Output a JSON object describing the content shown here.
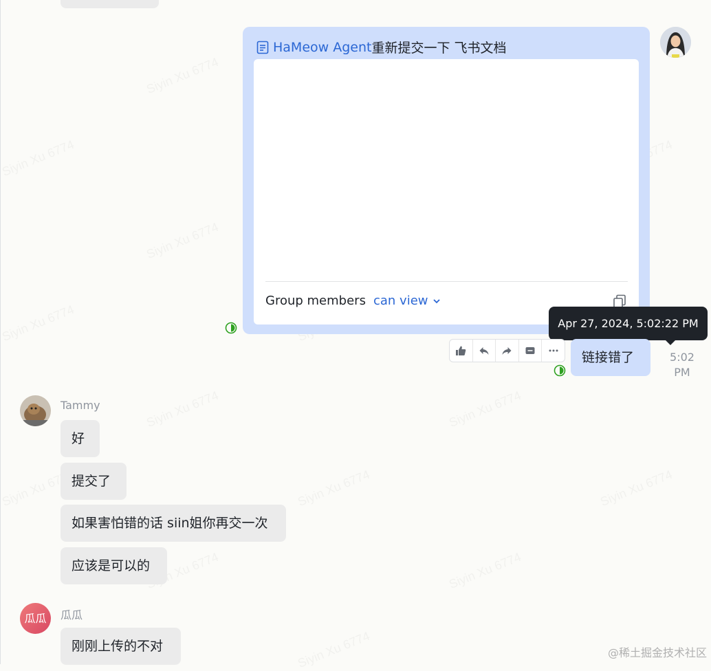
{
  "watermark_text": "Siyin Xu 6774",
  "card": {
    "icon": "document-icon",
    "link_text": "HaMeow Agent",
    "rest_text": "重新提交一下 飞书文档",
    "permission_label": "Group members",
    "permission_value": "can view"
  },
  "self_message": {
    "text": "链接错了"
  },
  "tooltip": {
    "text": "Apr 27, 2024, 5:02:22 PM"
  },
  "time": {
    "line1": "5:02",
    "line2": "PM"
  },
  "toolbar": {
    "icons": [
      "thumbs-up-icon",
      "reply-icon",
      "forward-icon",
      "quote-icon",
      "more-icon"
    ]
  },
  "groups": [
    {
      "sender": "Tammy",
      "messages": [
        "好",
        "提交了",
        "如果害怕错的话 siin姐你再交一次",
        "应该是可以的"
      ]
    },
    {
      "sender": "瓜瓜",
      "avatar_text": "瓜瓜",
      "messages": [
        "刚刚上传的不对"
      ]
    }
  ],
  "footer": {
    "credit": "@稀土掘金技术社区"
  },
  "colors": {
    "self_bubble": "#cfdefc",
    "other_bubble": "#ebebeb",
    "link": "#2b67d4",
    "status_green": "#2ea121",
    "tooltip_bg": "#1f2329"
  }
}
